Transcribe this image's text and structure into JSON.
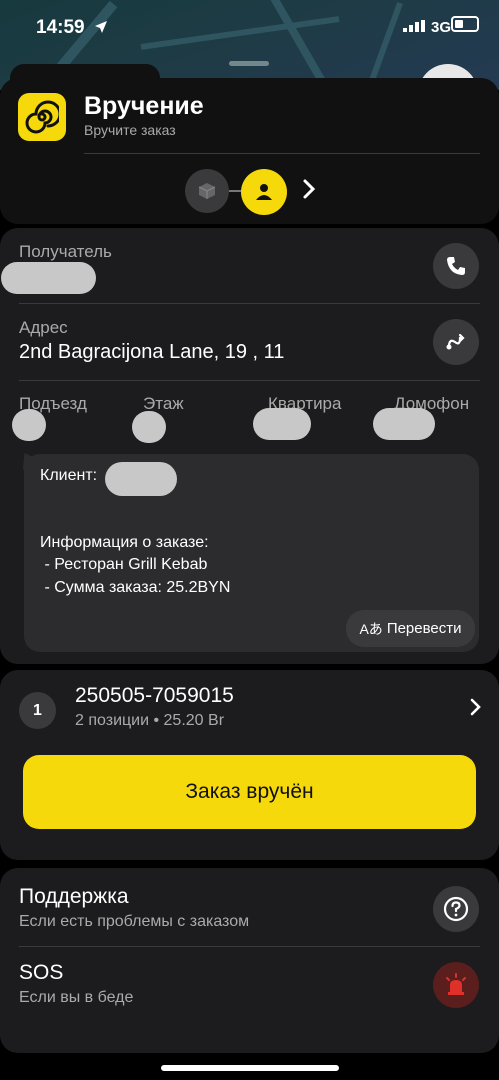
{
  "status_bar": {
    "time": "14:59",
    "network": "3G"
  },
  "header": {
    "title": "Вручение",
    "subtitle": "Вручите заказ"
  },
  "recipient": {
    "label": "Получатель"
  },
  "address": {
    "label": "Адрес",
    "value": "2nd Bagracijona Lane, 19 , 11"
  },
  "details": {
    "entrance": "Подъезд",
    "floor": "Этаж",
    "apartment": "Квартира",
    "intercom": "Домофон"
  },
  "comment": {
    "client_label": "Клиент:",
    "info_title": "Информация о заказе:",
    "line1": " - Ресторан Grill Kebab",
    "line2": " - Сумма заказа: 25.2BYN",
    "translate_label": "Перевести"
  },
  "order": {
    "number": "1",
    "id": "250505-7059015",
    "summary": "2 позиции • 25.20 Br"
  },
  "deliver_button": "Заказ вручён",
  "support": {
    "title": "Поддержка",
    "subtitle": "Если есть проблемы с заказом"
  },
  "sos": {
    "title": "SOS",
    "subtitle": "Если вы в беде"
  },
  "colors": {
    "accent": "#f5d90a",
    "sos": "#e0302a"
  }
}
